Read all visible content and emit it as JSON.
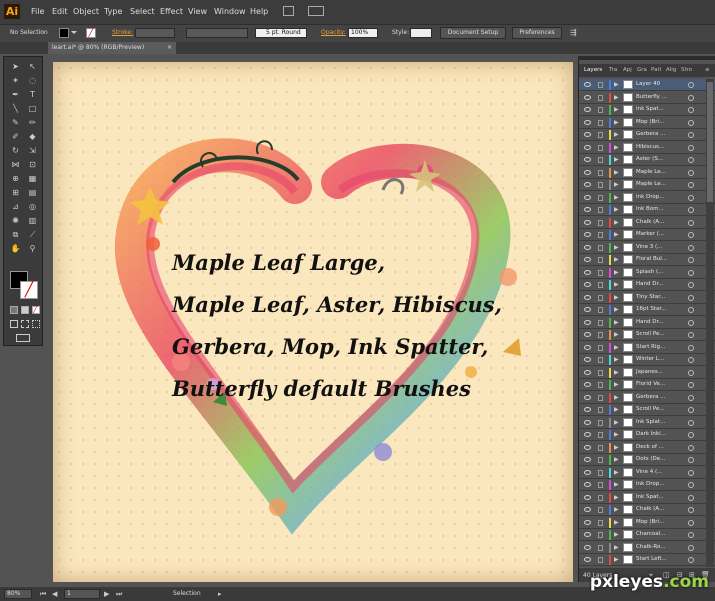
{
  "app": {
    "logo": "Ai"
  },
  "menu": [
    "File",
    "Edit",
    "Object",
    "Type",
    "Select",
    "Effect",
    "View",
    "Window",
    "Help"
  ],
  "control": {
    "selection": "No Selection",
    "stroke_label": "Stroke:",
    "brush_size": "5 pt. Round",
    "opacity_label": "Opacity:",
    "opacity_value": "100%",
    "style_label": "Style:",
    "document_setup": "Document Setup",
    "preferences": "Preferences"
  },
  "document_tab": "leart.ai* @ 80% (RGB/Preview)",
  "canvas_text": [
    "Maple Leaf Large,",
    "Maple Leaf, Aster, Hibiscus,",
    "Gerbera, Mop, Ink Spatter,",
    "Butterfly default Brushes"
  ],
  "panel_tabs": [
    "Layers",
    "Tra",
    "Apj",
    "Gra",
    "Patl",
    "Alig",
    "Stro"
  ],
  "layers": [
    {
      "name": "Layer 40",
      "color": "#4a7bd8",
      "expanded": false,
      "selected": true
    },
    {
      "name": "Butterfly ...",
      "color": "#e84545"
    },
    {
      "name": "Ink Spat...",
      "color": "#4ab84a"
    },
    {
      "name": "Mop (Bri...",
      "color": "#4a7bd8"
    },
    {
      "name": "Gerbera ...",
      "color": "#e8d84a"
    },
    {
      "name": "Hibiscus...",
      "color": "#d84ad8"
    },
    {
      "name": "Aster (S...",
      "color": "#4ad8d8"
    },
    {
      "name": "Maple Le...",
      "color": "#e8904a"
    },
    {
      "name": "Maple Le...",
      "color": "#8a8a8a"
    },
    {
      "name": "Ink Drop...",
      "color": "#4ab84a"
    },
    {
      "name": "Ink Bom...",
      "color": "#4a7bd8"
    },
    {
      "name": "Chalk (A...",
      "color": "#e84545"
    },
    {
      "name": "Marker (...",
      "color": "#4a7bd8"
    },
    {
      "name": "Vine 3 (...",
      "color": "#4ab84a"
    },
    {
      "name": "Floral Bul...",
      "color": "#e8d84a"
    },
    {
      "name": "Splash (...",
      "color": "#d84ad8"
    },
    {
      "name": "Hand Dr...",
      "color": "#4ad8d8"
    },
    {
      "name": "Tiny Star...",
      "color": "#e84545"
    },
    {
      "name": "16pt Star...",
      "color": "#4a7bd8"
    },
    {
      "name": "Hand Dr...",
      "color": "#4ab84a"
    },
    {
      "name": "Scroll Pe...",
      "color": "#e8904a"
    },
    {
      "name": "Start Rig...",
      "color": "#d84ad8"
    },
    {
      "name": "Winter L...",
      "color": "#4ad8d8"
    },
    {
      "name": "Japanes...",
      "color": "#e8d84a"
    },
    {
      "name": "Florid Ve...",
      "color": "#4ab84a"
    },
    {
      "name": "Gerbera ...",
      "color": "#e84545"
    },
    {
      "name": "Scroll Pe...",
      "color": "#4a7bd8"
    },
    {
      "name": "Ink Splat...",
      "color": "#8a8a8a"
    },
    {
      "name": "Dark Inki...",
      "color": "#4a7bd8"
    },
    {
      "name": "Deck of ...",
      "color": "#e8904a"
    },
    {
      "name": "Dots (De...",
      "color": "#4ab84a"
    },
    {
      "name": "Vine 4 (...",
      "color": "#4ad8d8"
    },
    {
      "name": "Ink Drop...",
      "color": "#d84ad8"
    },
    {
      "name": "Ink Spat...",
      "color": "#e84545"
    },
    {
      "name": "Chalk (A...",
      "color": "#4a7bd8"
    },
    {
      "name": "Mop (Bri...",
      "color": "#e8d84a"
    },
    {
      "name": "Charcoal...",
      "color": "#4ab84a"
    },
    {
      "name": "Chalk-Ro...",
      "color": "#8a8a8a"
    },
    {
      "name": "Start Left...",
      "color": "#e84545"
    }
  ],
  "layers_footer": "40 Layers",
  "status": {
    "zoom": "80%",
    "artboard": "1",
    "mode": "Selection"
  },
  "watermark": {
    "main": "pxleyes",
    "suffix": ".com"
  }
}
